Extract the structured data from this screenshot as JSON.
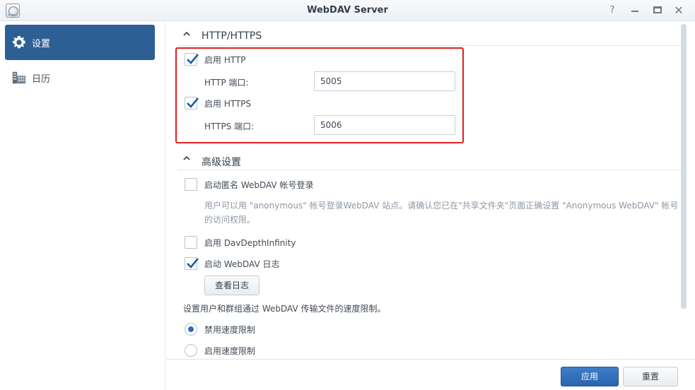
{
  "window": {
    "title": "WebDAV Server",
    "help_glyph": "?",
    "close_glyph": "✕"
  },
  "sidebar": {
    "items": [
      {
        "label": "设置",
        "icon": "gear-icon",
        "active": true
      },
      {
        "label": "日历",
        "icon": "calendar-building-icon",
        "active": false
      }
    ]
  },
  "http_section": {
    "title": "HTTP/HTTPS",
    "enable_http": {
      "label": "启用 HTTP",
      "checked": true
    },
    "http_port": {
      "label": "HTTP 端口:",
      "value": "5005"
    },
    "enable_https": {
      "label": "启用 HTTPS",
      "checked": true
    },
    "https_port": {
      "label": "HTTPS 端口:",
      "value": "5006"
    }
  },
  "advanced_section": {
    "title": "高级设置",
    "anonymous": {
      "label": "启动匿名 WebDAV 帐号登录",
      "checked": false
    },
    "anonymous_note": "用户可以用 \"anonymous\" 帐号登录WebDAV 站点。请确认您已在\"共享文件夹\"页面正确设置 \"Anonymous WebDAV\" 帐号的访问权限。",
    "depth_infinity": {
      "label": "启用 DavDepthInfinity",
      "checked": false
    },
    "webdav_log": {
      "label": "启动 WebDAV 日志",
      "checked": true
    },
    "view_log_button": "查看日志",
    "speed_limit_text": "设置用户和群组通过 WebDAV 传输文件的速度限制。",
    "speed_options": [
      {
        "label": "禁用速度限制",
        "selected": true
      },
      {
        "label": "启用速度限制",
        "selected": false
      }
    ]
  },
  "footer": {
    "apply_label": "应用",
    "reset_label": "重置"
  },
  "colors": {
    "accent": "#2d5f95",
    "apply_button": "#2b64ad",
    "highlight_border": "#e02020",
    "check": "#1f5aa0"
  }
}
